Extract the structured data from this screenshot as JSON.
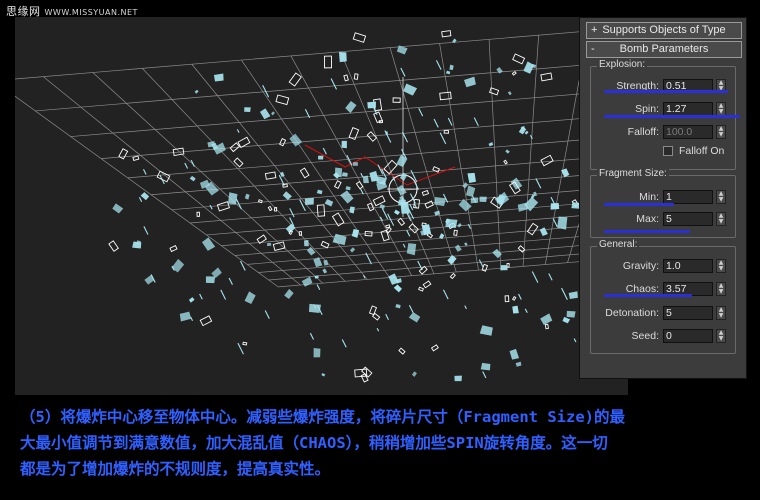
{
  "watermark": {
    "name": "思缘网",
    "site": "WWW.MISSYUAN.NET"
  },
  "panel": {
    "rollouts": [
      {
        "sign": "+",
        "label": "Supports Objects of Type"
      },
      {
        "sign": "-",
        "label": "Bomb Parameters"
      }
    ],
    "explosion": {
      "title": "Explosion:",
      "strength": {
        "label": "Strength:",
        "value": "0.51"
      },
      "spin": {
        "label": "Spin:",
        "value": "1.27"
      },
      "falloff": {
        "label": "Falloff:",
        "value": "100.0"
      },
      "falloff_on": {
        "label": "Falloff On",
        "checked": false
      }
    },
    "fragment": {
      "title": "Fragment Size:",
      "min": {
        "label": "Min:",
        "value": "1"
      },
      "max": {
        "label": "Max:",
        "value": "5"
      }
    },
    "general": {
      "title": "General:",
      "gravity": {
        "label": "Gravity:",
        "value": "1.0"
      },
      "chaos": {
        "label": "Chaos:",
        "value": "3.57"
      },
      "detonation": {
        "label": "Detonation:",
        "value": "5"
      },
      "seed": {
        "label": "Seed:",
        "value": "0"
      }
    }
  },
  "caption": {
    "line1": "（5）将爆炸中心移至物体中心。减弱些爆炸强度，将碎片尺寸（Fragment Size)的最",
    "line2": "大最小值调节到满意数值，加大混乱值（CHAOS），稍稍增加些SPIN旋转角度。这一切",
    "line3": "都是为了增加爆炸的不规则度，提高真实性。"
  },
  "colors": {
    "viewport_bg": "#222222",
    "grid": "#8c8c8c",
    "fragment": "#a8e4ee",
    "axis_red": "#d01010",
    "highlight": "#2a2fd8",
    "caption": "#3060ff"
  }
}
